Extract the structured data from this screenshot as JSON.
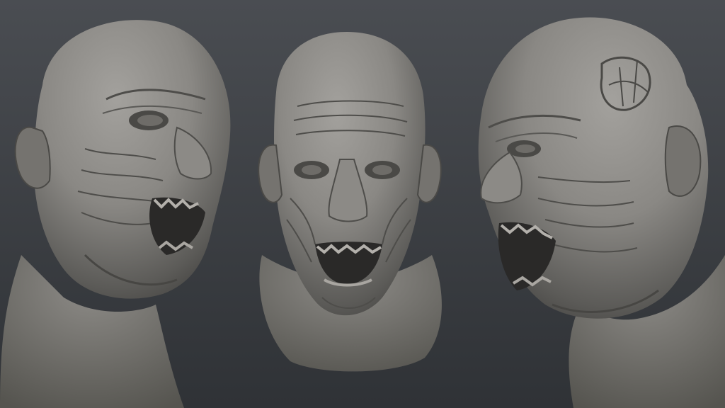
{
  "scene": {
    "description_visible_text": [],
    "colors": {
      "background_top": "#4a4d52",
      "background_bottom": "#2f3236",
      "clay_light": "#a3a19d",
      "clay_mid": "#7c7a76",
      "clay_dark": "#3c3b39",
      "mouth_shadow": "#2a2928"
    },
    "views": [
      {
        "id": "three-quarter-left"
      },
      {
        "id": "front"
      },
      {
        "id": "three-quarter-right"
      }
    ]
  }
}
